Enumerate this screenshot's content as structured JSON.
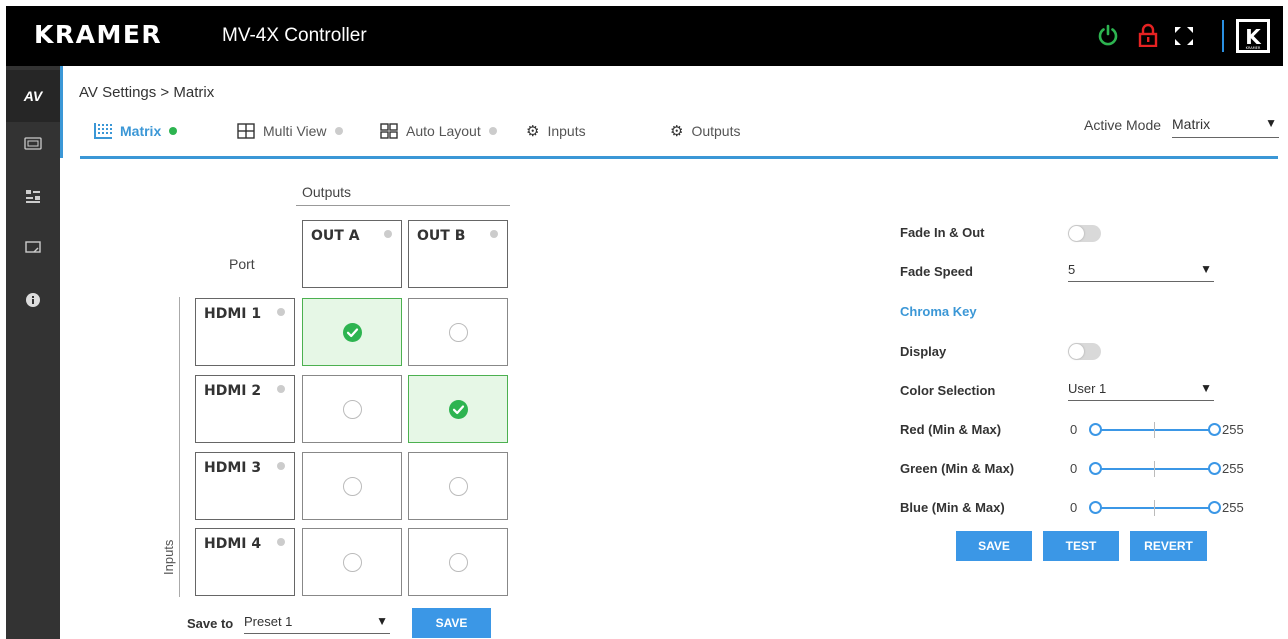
{
  "header": {
    "brand": "KRAMER",
    "title": "MV-4X Controller",
    "logo_letter": "K",
    "logo_sub": "KRAMER"
  },
  "sidebar": {
    "items": [
      {
        "label": "AV",
        "icon": "av-icon"
      },
      {
        "icon": "edid-icon"
      },
      {
        "icon": "settings-sliders-icon"
      },
      {
        "icon": "display-icon"
      },
      {
        "icon": "info-icon"
      }
    ]
  },
  "breadcrumb": "AV Settings > Matrix",
  "tabs": [
    {
      "label": "Matrix",
      "status": "green"
    },
    {
      "label": "Multi View",
      "status": "gray"
    },
    {
      "label": "Auto Layout",
      "status": "gray"
    },
    {
      "label": "Inputs"
    },
    {
      "label": "Outputs"
    }
  ],
  "active_mode": {
    "label": "Active Mode",
    "value": "Matrix"
  },
  "matrix": {
    "outputs_label": "Outputs",
    "port_label": "Port",
    "inputs_label": "Inputs",
    "outputs": [
      "OUT A",
      "OUT B"
    ],
    "inputs": [
      "HDMI 1",
      "HDMI 2",
      "HDMI 3",
      "HDMI 4"
    ],
    "routing": [
      [
        true,
        false
      ],
      [
        false,
        true
      ],
      [
        false,
        false
      ],
      [
        false,
        false
      ]
    ],
    "save_to_label": "Save to",
    "preset_value": "Preset 1",
    "save_button": "SAVE"
  },
  "panel": {
    "fade_label": "Fade In & Out",
    "fade_speed_label": "Fade Speed",
    "fade_speed_value": "5",
    "chroma_title": "Chroma Key",
    "display_label": "Display",
    "color_selection_label": "Color Selection",
    "color_selection_value": "User 1",
    "red_label": "Red (Min & Max)",
    "green_label": "Green (Min & Max)",
    "blue_label": "Blue (Min & Max)",
    "red_min": "0",
    "red_max": "255",
    "green_min": "0",
    "green_max": "255",
    "blue_min": "0",
    "blue_max": "255",
    "save": "SAVE",
    "test": "TEST",
    "revert": "REVERT"
  },
  "colors": {
    "accent": "#3b97e6",
    "active_green": "#2db450",
    "lock_red": "#e52222"
  }
}
